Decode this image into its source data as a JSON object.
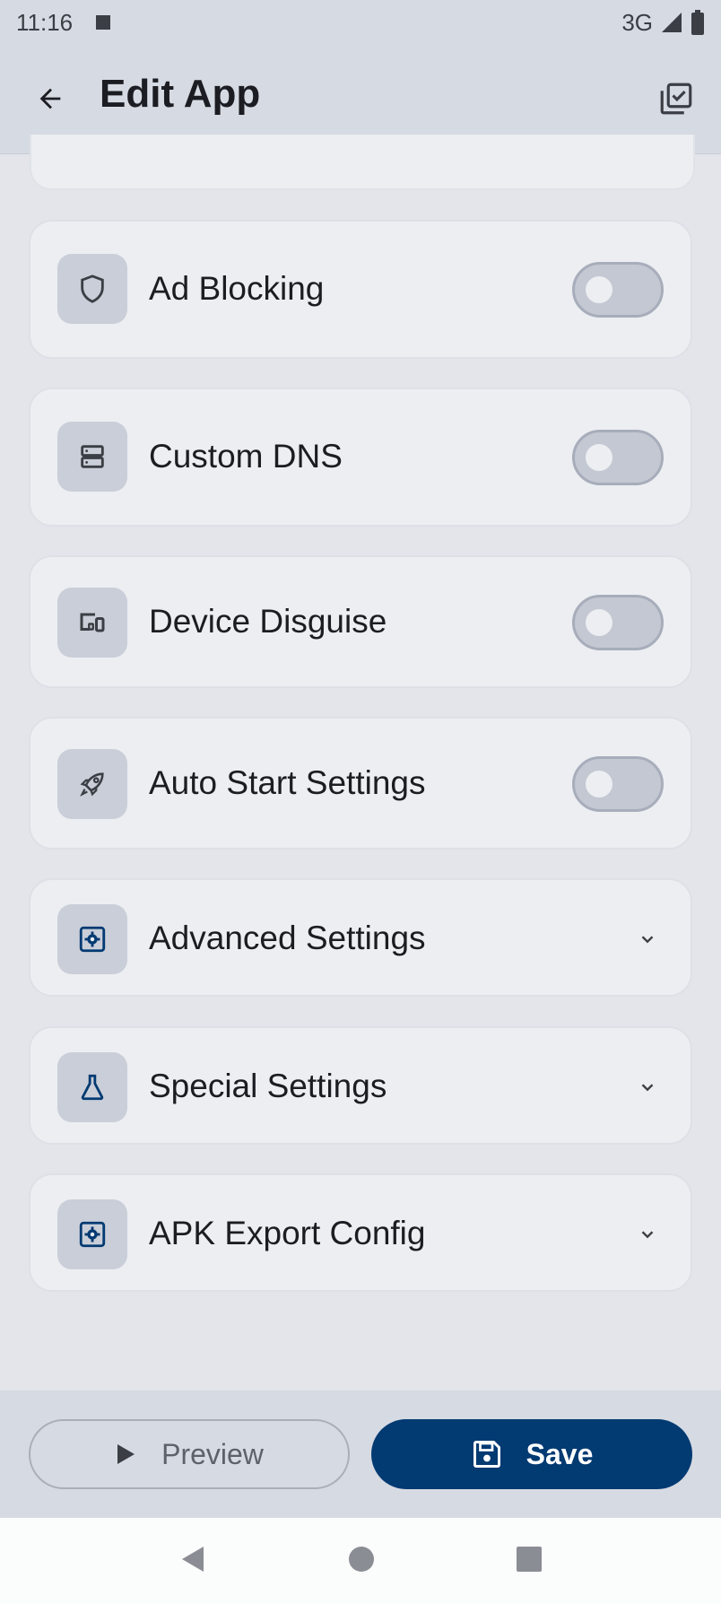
{
  "status_bar": {
    "time": "11:16",
    "network": "3G"
  },
  "app_bar": {
    "title": "Edit App"
  },
  "cards": [
    {
      "label": "Ad Blocking",
      "icon": "shield-icon",
      "type": "toggle",
      "enabled": false
    },
    {
      "label": "Custom DNS",
      "icon": "dns-server-icon",
      "type": "toggle",
      "enabled": false
    },
    {
      "label": "Device Disguise",
      "icon": "devices-icon",
      "type": "toggle",
      "enabled": false
    },
    {
      "label": "Auto Start Settings",
      "icon": "rocket-icon",
      "type": "toggle",
      "enabled": false
    },
    {
      "label": "Advanced Settings",
      "icon": "settings-applications-icon",
      "type": "expandable",
      "expanded": false
    },
    {
      "label": "Special Settings",
      "icon": "flask-icon",
      "type": "expandable",
      "expanded": false
    },
    {
      "label": "APK Export Config",
      "icon": "settings-applications-icon",
      "type": "expandable",
      "expanded": false
    }
  ],
  "bottom_actions": {
    "preview_label": "Preview",
    "save_label": "Save"
  },
  "colors": {
    "accent": "#023a72",
    "background": "#e3e5ea",
    "card": "#eceef2",
    "bar": "#d6dae2"
  }
}
